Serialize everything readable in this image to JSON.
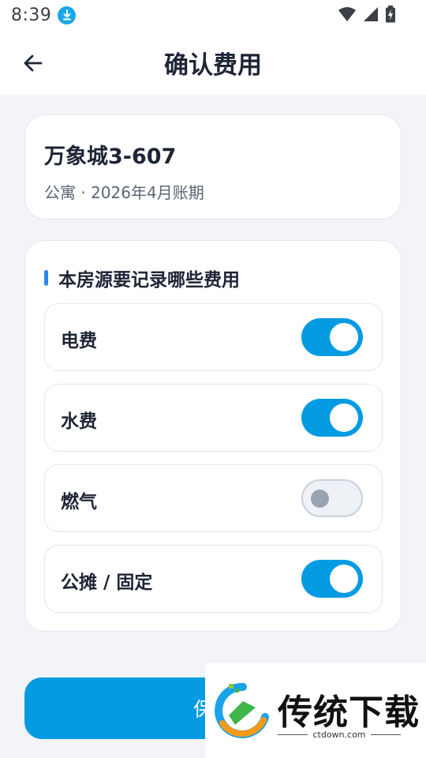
{
  "status_bar": {
    "time": "8:39",
    "icons": [
      "download-icon",
      "wifi-icon",
      "signal-icon",
      "battery-charging-icon"
    ]
  },
  "header": {
    "title": "确认费用",
    "back_icon": "arrow-left-icon"
  },
  "property": {
    "name": "万象城3-607",
    "subtitle": "公寓 · 2026年4月账期"
  },
  "fees_section": {
    "title": "本房源要记录哪些费用",
    "items": [
      {
        "label": "电费",
        "enabled": true
      },
      {
        "label": "水费",
        "enabled": true
      },
      {
        "label": "燃气",
        "enabled": false
      },
      {
        "label": "公摊 / 固定",
        "enabled": true
      }
    ]
  },
  "save_button": {
    "label": "保存"
  },
  "watermark": {
    "brand": "传统下载",
    "url": "ctdown.com"
  },
  "colors": {
    "accent": "#049be2",
    "section_bar": "#2f86e8",
    "background": "#f2f4f7",
    "toggle_off_knob": "#9aa3b3"
  }
}
